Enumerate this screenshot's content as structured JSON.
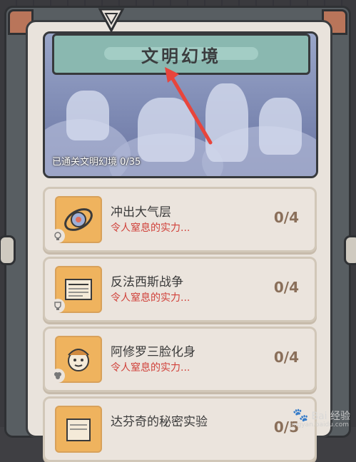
{
  "banner": {
    "title": "文明幻境",
    "progress": "已通关文明幻境 0/35"
  },
  "cards": [
    {
      "name": "冲出大气层",
      "desc": "令人窒息的实力...",
      "count": "0/4",
      "icon": "rocket-ring-icon",
      "badge": "bulb-icon"
    },
    {
      "name": "反法西斯战争",
      "desc": "令人窒息的实力...",
      "count": "0/4",
      "icon": "newspaper-icon",
      "badge": "trophy-icon"
    },
    {
      "name": "阿修罗三脸化身",
      "desc": "令人窒息的实力...",
      "count": "0/4",
      "icon": "mask-face-icon",
      "badge": "clover-icon"
    },
    {
      "name": "达芬奇的秘密实验",
      "desc": "",
      "count": "0/5",
      "icon": "scroll-icon",
      "badge": ""
    }
  ],
  "watermark": {
    "text": "Bai 经验",
    "subtext": "jingyan.baidu.com"
  },
  "colors": {
    "accent_red": "#d0413a",
    "plate_teal": "#8ab8b0",
    "icon_orange": "#efb35e",
    "annotation_arrow": "#e8453c"
  }
}
